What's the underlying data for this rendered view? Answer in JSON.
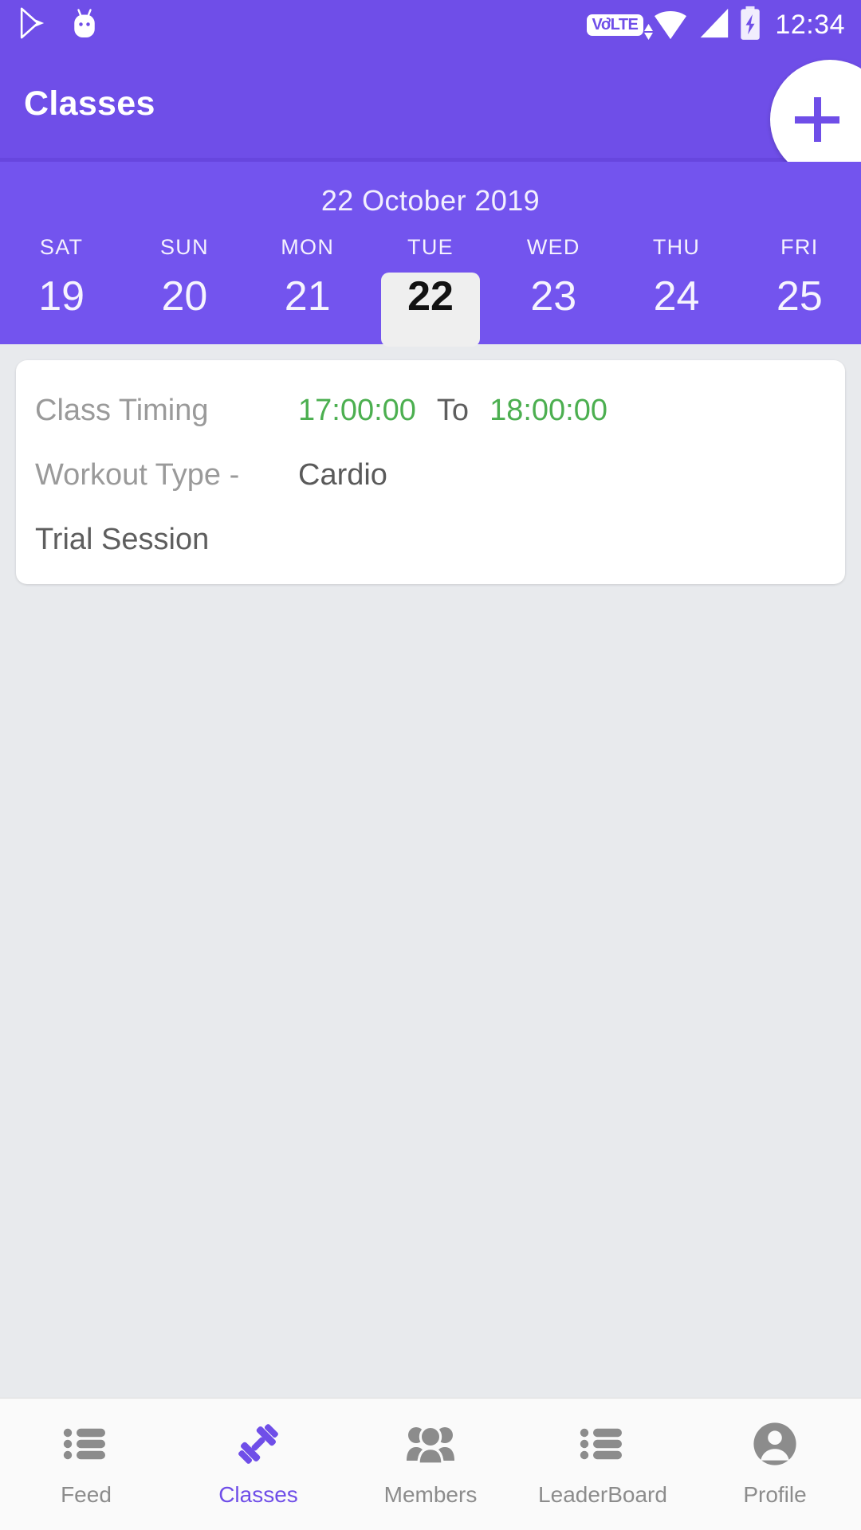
{
  "colors": {
    "primary": "#6F4EE8",
    "calendar_bg": "#7354EE",
    "page_bg": "#E8EAED",
    "time_green": "#4CAF50",
    "selected_tile": "#EFEFEF",
    "muted_text": "#9A9A9A"
  },
  "status_bar": {
    "icons": [
      "play-store-icon",
      "android-head-icon"
    ],
    "volte_label": "VoLTE",
    "signal_icons": [
      "wifi-icon",
      "cellular-signal-icon",
      "battery-charging-icon"
    ],
    "time": "12:34"
  },
  "app_bar": {
    "title": "Classes",
    "settings_icon": "gear-icon",
    "fab_icon": "plus-icon"
  },
  "calendar": {
    "selected_date_label": "22 October 2019",
    "days": [
      {
        "dow": "SAT",
        "num": "19",
        "selected": false
      },
      {
        "dow": "SUN",
        "num": "20",
        "selected": false
      },
      {
        "dow": "MON",
        "num": "21",
        "selected": false
      },
      {
        "dow": "TUE",
        "num": "22",
        "selected": true
      },
      {
        "dow": "WED",
        "num": "23",
        "selected": false
      },
      {
        "dow": "THU",
        "num": "24",
        "selected": false
      },
      {
        "dow": "FRI",
        "num": "25",
        "selected": false
      }
    ]
  },
  "class_card": {
    "timing_label": "Class Timing",
    "start_time": "17:00:00",
    "to_label": "To",
    "end_time": "18:00:00",
    "workout_label": "Workout Type -",
    "workout_value": "Cardio",
    "session_type": "Trial Session"
  },
  "bottom_nav": {
    "items": [
      {
        "label": "Feed",
        "icon": "list-icon",
        "active": false
      },
      {
        "label": "Classes",
        "icon": "dumbbell-icon",
        "active": true
      },
      {
        "label": "Members",
        "icon": "people-group-icon",
        "active": false
      },
      {
        "label": "LeaderBoard",
        "icon": "list-icon",
        "active": false
      },
      {
        "label": "Profile",
        "icon": "person-circle-icon",
        "active": false
      }
    ]
  }
}
